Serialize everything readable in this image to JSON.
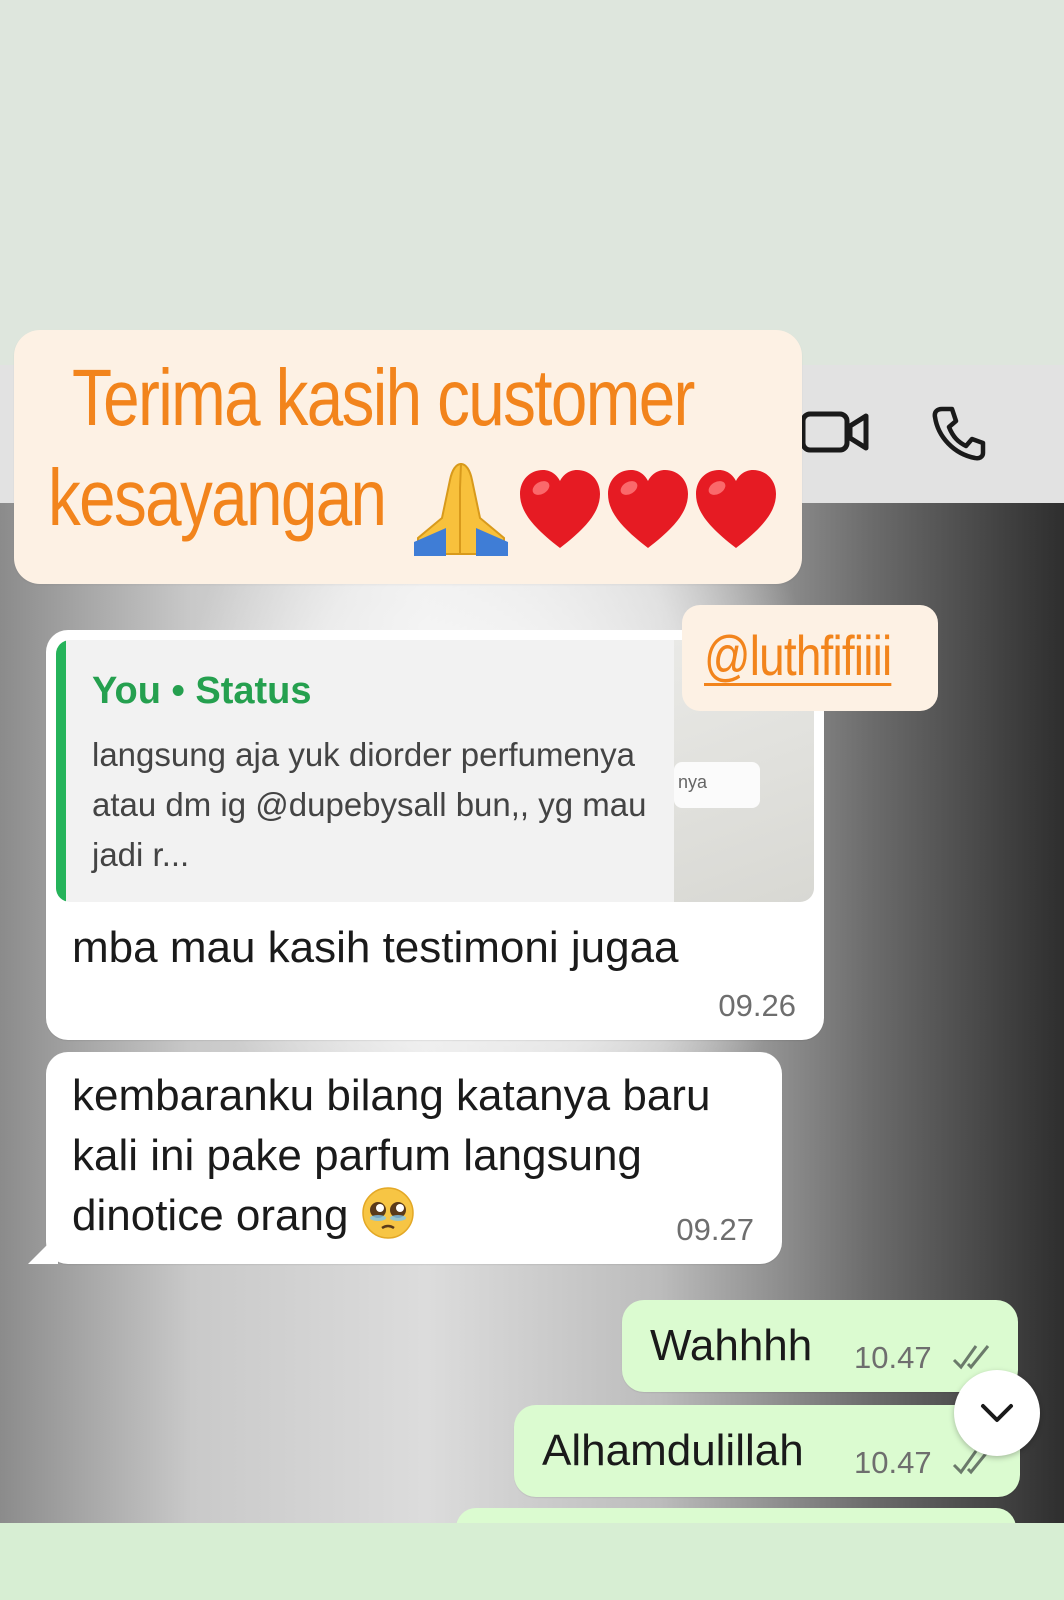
{
  "banner": {
    "line1": "Terima kasih customer",
    "line2": "kesayangan",
    "emojis": [
      "folded-hands",
      "red-heart",
      "red-heart",
      "red-heart"
    ],
    "text_color": "#f2841c",
    "background": "#fdf1e4"
  },
  "handle": {
    "text": "@luthfifiiii"
  },
  "header": {
    "icons": [
      "video-camera-icon",
      "phone-icon"
    ]
  },
  "messages": {
    "m1": {
      "quote_sender": "You • Status",
      "quote_text": "langsung aja yuk diorder perfumenya atau dm ig @dupebysall bun,, yg mau jadi r...",
      "quote_thumb_text": "nya",
      "text": "mba mau kasih testimoni jugaa",
      "time": "09.26"
    },
    "m2": {
      "text": "kembaranku bilang katanya baru kali ini pake parfum langsung dinotice orang",
      "emoji": "pleading-face",
      "time": "09.27"
    },
    "m3": {
      "text": "Wahhhh",
      "time": "10.47",
      "status": "read"
    },
    "m4": {
      "text": "Alhamdulillah",
      "time": "10.47",
      "status": "read"
    }
  },
  "colors": {
    "incoming_bubble": "#ffffff",
    "outgoing_bubble": "#dbfbd0",
    "quote_accent": "#25b35a"
  }
}
